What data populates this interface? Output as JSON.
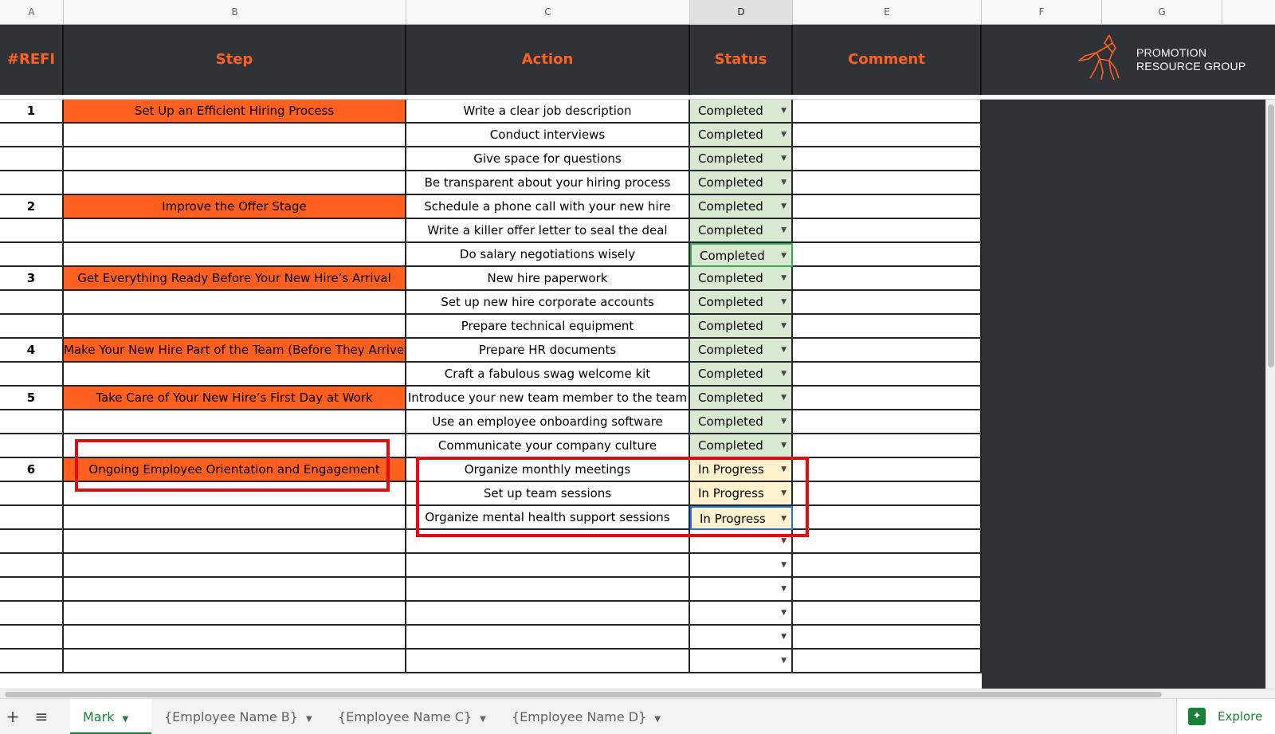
{
  "columns": [
    "A",
    "B",
    "C",
    "D",
    "E",
    "F",
    "G"
  ],
  "header": {
    "ref": "#REFI",
    "step": "Step",
    "action": "Action",
    "status": "Status",
    "comment": "Comment"
  },
  "logo": {
    "line1": "PROMOTION",
    "line2": "RESOURCE GROUP",
    "icon": "origami-horse-icon"
  },
  "colors": {
    "accent_orange": "#ff5f1f",
    "header_dark": "#2f3337",
    "completed_fill": "#d9ead3",
    "in_progress_fill": "#fff2cc",
    "annotation_red": "#e50914",
    "active_tab_green": "#188038"
  },
  "rows": [
    {
      "ref": "1",
      "step": "Set Up an Efficient Hiring Process",
      "action": "Write a clear job description",
      "status": "Completed"
    },
    {
      "ref": "",
      "step": "",
      "action": "Conduct interviews",
      "status": "Completed"
    },
    {
      "ref": "",
      "step": "",
      "action": "Give space for questions",
      "status": "Completed"
    },
    {
      "ref": "",
      "step": "",
      "action": "Be transparent about your hiring process",
      "status": "Completed"
    },
    {
      "ref": "2",
      "step": "Improve the Offer Stage",
      "action": "Schedule a phone call with your new hire",
      "status": "Completed"
    },
    {
      "ref": "",
      "step": "",
      "action": "Write a killer offer letter to seal the deal",
      "status": "Completed"
    },
    {
      "ref": "",
      "step": "",
      "action": "Do salary negotiations wisely",
      "status": "Completed"
    },
    {
      "ref": "3",
      "step": "Get Everything Ready Before Your New Hire’s Arrival",
      "action": "New hire paperwork",
      "status": "Completed"
    },
    {
      "ref": "",
      "step": "",
      "action": "Set up new hire corporate accounts",
      "status": "Completed"
    },
    {
      "ref": "",
      "step": "",
      "action": "Prepare technical equipment",
      "status": "Completed"
    },
    {
      "ref": "4",
      "step": "Make Your New Hire Part of the Team (Before They Arrive)",
      "action": "Prepare HR documents",
      "status": "Completed"
    },
    {
      "ref": "",
      "step": "",
      "action": "Craft a fabulous swag welcome kit",
      "status": "Completed"
    },
    {
      "ref": "5",
      "step": "Take Care of Your New Hire’s First Day at Work",
      "action": "Introduce your new team member to the team",
      "status": "Completed"
    },
    {
      "ref": "",
      "step": "",
      "action": "Use an employee onboarding software",
      "status": "Completed"
    },
    {
      "ref": "",
      "step": "",
      "action": "Communicate your company culture",
      "status": "Completed"
    },
    {
      "ref": "6",
      "step": "Ongoing Employee Orientation and Engagement",
      "action": "Organize monthly meetings",
      "status": "In Progress"
    },
    {
      "ref": "",
      "step": "",
      "action": "Set up team sessions",
      "status": "In Progress"
    },
    {
      "ref": "",
      "step": "",
      "action": "Organize mental health support sessions",
      "status": "In Progress"
    },
    {
      "ref": "",
      "step": "",
      "action": "",
      "status": ""
    },
    {
      "ref": "",
      "step": "",
      "action": "",
      "status": ""
    },
    {
      "ref": "",
      "step": "",
      "action": "",
      "status": ""
    },
    {
      "ref": "",
      "step": "",
      "action": "",
      "status": ""
    },
    {
      "ref": "",
      "step": "",
      "action": "",
      "status": ""
    },
    {
      "ref": "",
      "step": "",
      "action": "",
      "status": ""
    }
  ],
  "tabs": [
    {
      "label": "Mark",
      "active": true
    },
    {
      "label": "{Employee Name B}",
      "active": false
    },
    {
      "label": "{Employee Name C}",
      "active": false
    },
    {
      "label": "{Employee Name D}",
      "active": false
    }
  ],
  "toolbar": {
    "add_sheet_icon": "plus-icon",
    "all_sheets_icon": "list-icon",
    "explore_label": "Explore",
    "explore_icon": "explore-sparkle-icon"
  }
}
